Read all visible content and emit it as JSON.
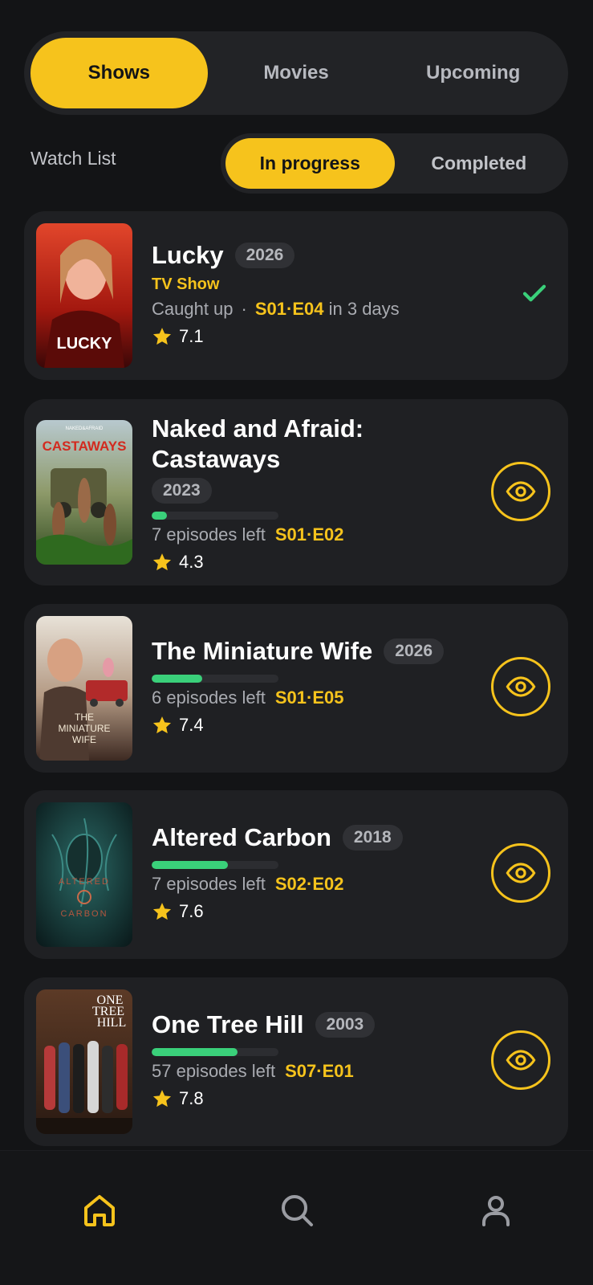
{
  "tabs": {
    "top": [
      {
        "label": "Shows",
        "active": true
      },
      {
        "label": "Movies",
        "active": false
      },
      {
        "label": "Upcoming",
        "active": false
      }
    ],
    "watch_list_label": "Watch List",
    "sub": [
      {
        "label": "In progress",
        "active": true
      },
      {
        "label": "Completed",
        "active": false
      }
    ]
  },
  "cards": [
    {
      "title": "Lucky",
      "year": "2026",
      "type": "TV Show",
      "status": "Caught up",
      "separator": "·",
      "episode": "S01·E04",
      "next_in": "in 3 days",
      "rating": "7.1",
      "action": "check-icon",
      "poster_text": "LUCKY"
    },
    {
      "title": "Naked and Afraid: Castaways",
      "year": "2023",
      "progress": 0.12,
      "episodes_left": "7 episodes left",
      "episode": "S01·E02",
      "rating": "4.3",
      "action": "eye-icon",
      "poster_text": "CASTAWAYS",
      "poster_kicker": "NAKED&AFRAID"
    },
    {
      "title": "The Miniature Wife",
      "year": "2026",
      "progress": 0.4,
      "episodes_left": "6 episodes left",
      "episode": "S01·E05",
      "rating": "7.4",
      "action": "eye-icon",
      "poster_text": [
        "THE",
        "MINIATURE",
        "WIFE"
      ]
    },
    {
      "title": "Altered Carbon",
      "year": "2018",
      "progress": 0.6,
      "episodes_left": "7 episodes left",
      "episode": "S02·E02",
      "rating": "7.6",
      "action": "eye-icon",
      "poster_text": [
        "ALTERED",
        "CARBON"
      ]
    },
    {
      "title": "One Tree Hill",
      "year": "2003",
      "progress": 0.68,
      "episodes_left": "57 episodes left",
      "episode": "S07·E01",
      "rating": "7.8",
      "action": "eye-icon",
      "poster_text": [
        "ONE",
        "TREE",
        "HILL"
      ]
    }
  ],
  "bottom_nav": [
    {
      "icon": "home-icon",
      "active": true
    },
    {
      "icon": "search-icon",
      "active": false
    },
    {
      "icon": "profile-icon",
      "active": false
    }
  ],
  "colors": {
    "accent": "#f6c31c",
    "progress": "#3ad07a",
    "check": "#3ad07a",
    "background": "#131416",
    "card": "#1f2023"
  }
}
